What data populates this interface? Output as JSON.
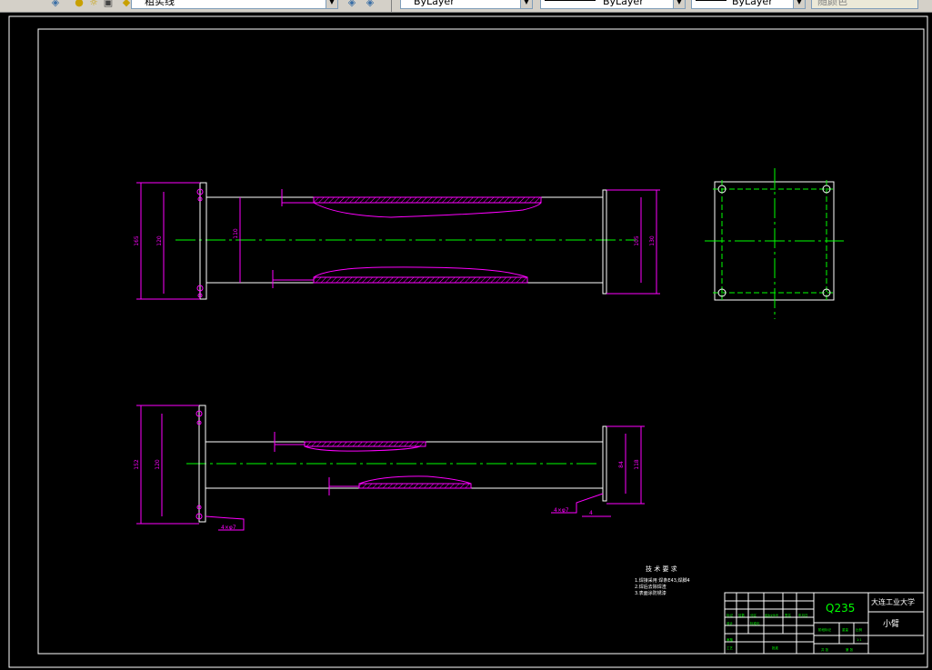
{
  "toolbar": {
    "layer_name": "粗实线",
    "color_value": "ByLayer",
    "linetype_value": "ByLayer",
    "lineweight_value": "ByLayer",
    "plotstyle_value": "随颜色"
  },
  "dimensions": {
    "front_outer_height": "165",
    "front_inner_height": "120",
    "front_pipe_diameter": "110",
    "front_right_inner": "105",
    "front_right_outer": "130",
    "bottom_outer_height": "152",
    "bottom_inner_height": "120",
    "bottom_right_inner": "84",
    "bottom_right_outer": "118",
    "bottom_left_note": "4×φ7",
    "bottom_right_note": "4×φ7",
    "bottom_right_small": "4"
  },
  "tech_requirements": {
    "title": "技 术 要 求",
    "lines": [
      "1.焊接采用 焊条E43,焊脚4",
      "2.焊后去除焊渣",
      "3.表面涂防锈漆"
    ]
  },
  "title_block": {
    "material": "Q235",
    "university": "大连工业大学",
    "part_name": "小臂",
    "cells": [
      "标记",
      "处数",
      "分区",
      "更改文件号",
      "签名",
      "年月日",
      "设计",
      "标准化",
      "审核",
      "工艺",
      "批准",
      "阶段标记",
      "重量",
      "比例",
      "1:1",
      "共 张",
      "第 张"
    ]
  },
  "colors": {
    "white": "#ffffff",
    "magenta": "#ff00ff",
    "green": "#00ff00",
    "background": "#000000"
  }
}
